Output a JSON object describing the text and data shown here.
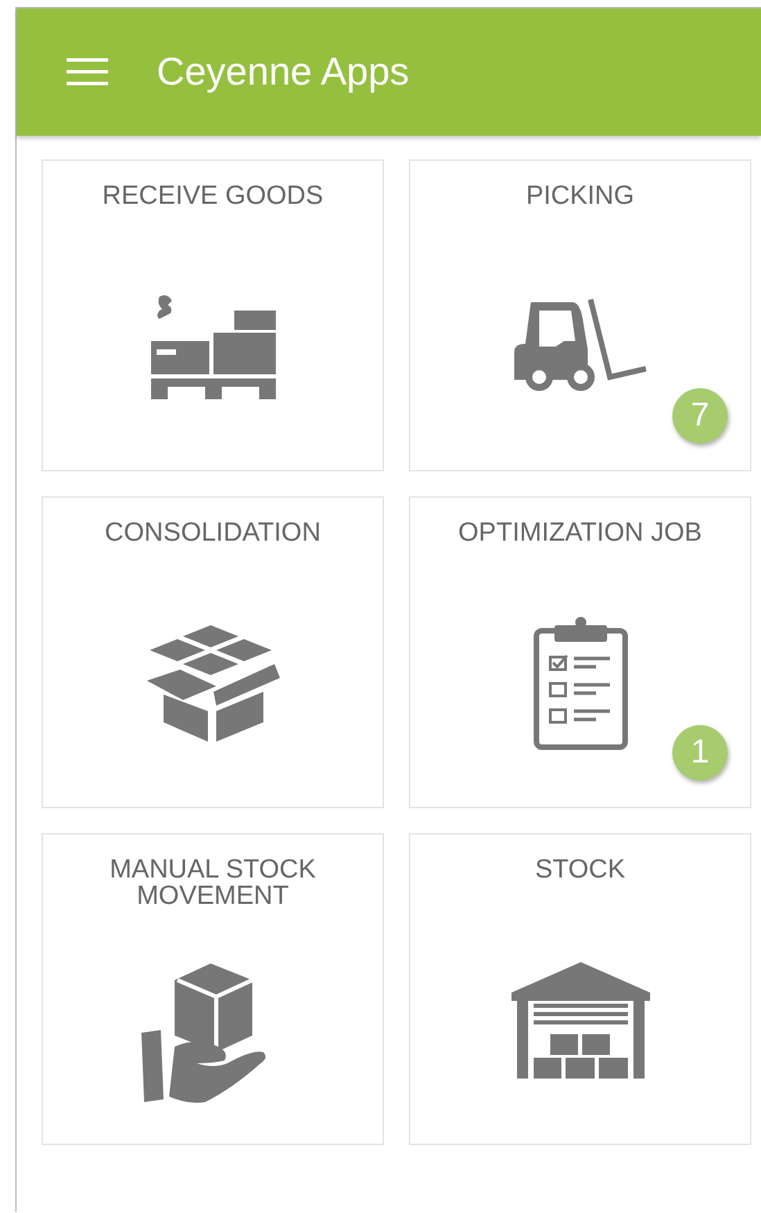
{
  "header": {
    "title": "Ceyenne Apps"
  },
  "tiles": [
    {
      "title": "RECEIVE GOODS",
      "kind": "receive"
    },
    {
      "title": "PICKING",
      "kind": "forklift",
      "badge": "7"
    },
    {
      "title": "CONSOLIDATION",
      "kind": "boxes"
    },
    {
      "title": "OPTIMIZATION JOB",
      "kind": "clipboard",
      "badge": "1"
    },
    {
      "title": "MANUAL STOCK MOVEMENT",
      "kind": "hand"
    },
    {
      "title": "STOCK",
      "kind": "warehouse"
    }
  ]
}
